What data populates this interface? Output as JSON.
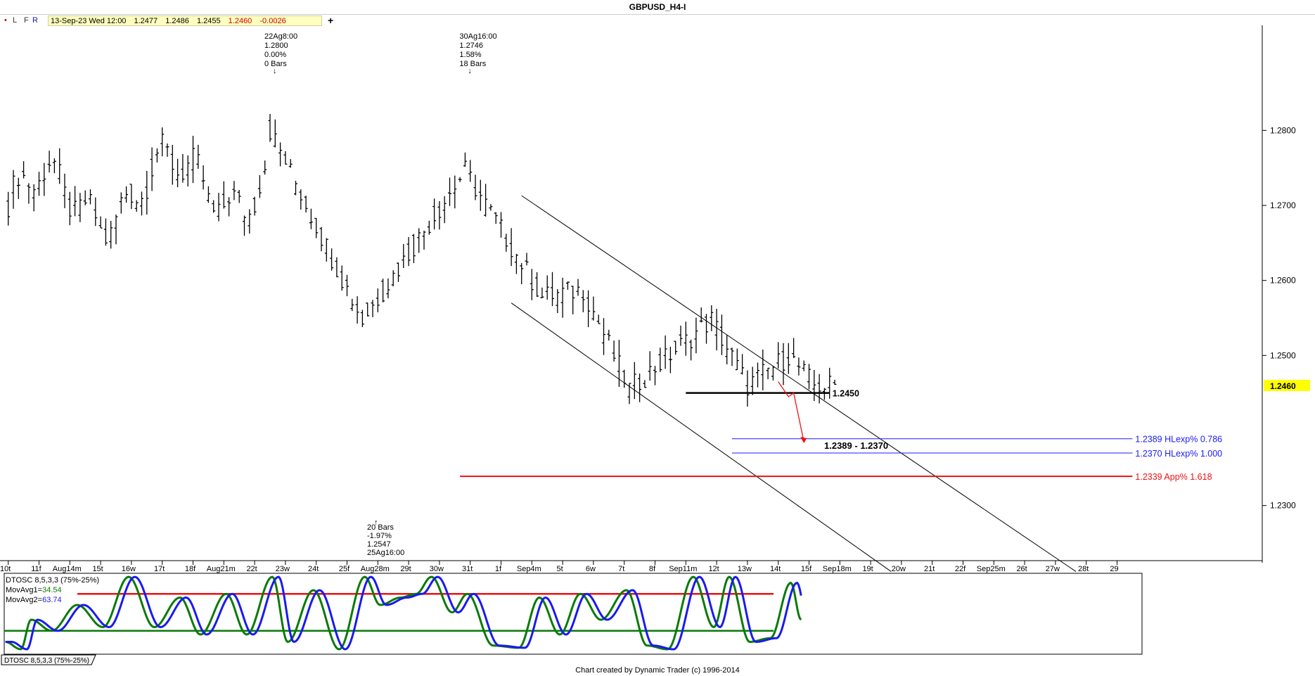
{
  "window": {
    "title": "GBPUSD_H4-I"
  },
  "toolbar": {
    "buttons": [
      {
        "label": "•",
        "color": "#cc0000"
      },
      {
        "label": "L",
        "color": "#333333"
      },
      {
        "label": "F",
        "color": "#333333"
      },
      {
        "label": "R",
        "color": "#1a1aa0"
      }
    ],
    "quote": {
      "date": "13-Sep-23 Wed 12:00",
      "open": "1.2477",
      "high": "1.2486",
      "low": "1.2455",
      "close": "1.2460",
      "change": "-0.0026"
    },
    "add_label": "+"
  },
  "footer": {
    "credit": "Chart created by Dynamic Trader  (c) 1996-2014"
  },
  "chart_data": [
    {
      "type": "ohlc",
      "symbol": "GBPUSD_H4-I",
      "ylim": [
        1.222,
        1.294
      ],
      "y_ticks": [
        "1.2800",
        "1.2700",
        "1.2600",
        "1.2500",
        "1.2300"
      ],
      "y_tick_values": [
        1.28,
        1.27,
        1.26,
        1.25,
        1.23
      ],
      "last_price_label": "1.2460",
      "last_price": 1.246,
      "x_tick_labels": [
        "10t",
        "11f",
        "Aug14m",
        "15t",
        "16w",
        "17t",
        "18f",
        "Aug21m",
        "22t",
        "23w",
        "24t",
        "25f",
        "Aug28m",
        "29t",
        "30w",
        "31t",
        "1f",
        "Sep4m",
        "5t",
        "6w",
        "7t",
        "8f",
        "Sep11m",
        "12t",
        "13w",
        "14t",
        "15f",
        "Sep18m",
        "19t",
        "20w",
        "21t",
        "22f",
        "Sep25m",
        "26t",
        "27w",
        "28t",
        "29"
      ],
      "bars_per_day": 6,
      "last_bar_index": 161,
      "swing_points": [
        {
          "index": 51,
          "price": 1.28
        },
        {
          "index": 69,
          "price": 1.2547
        },
        {
          "index": 89,
          "price": 1.2746
        },
        {
          "index": 104,
          "price": 1.2578
        },
        {
          "index": 112,
          "price": 1.2588
        },
        {
          "index": 121,
          "price": 1.2455
        },
        {
          "index": 137,
          "price": 1.2548
        },
        {
          "index": 144,
          "price": 1.246
        },
        {
          "index": 152,
          "price": 1.25
        },
        {
          "index": 157,
          "price": 1.246
        }
      ],
      "annotations": [
        {
          "lines": [
            "22Ag8:00",
            "1.2800",
            "0.00%",
            "0 Bars"
          ],
          "arrow": "↓",
          "index": 51,
          "position": "above"
        },
        {
          "lines": [
            "30Ag16:00",
            "1.2746",
            "1.58%",
            "18 Bars"
          ],
          "arrow": "↓",
          "index": 89,
          "position": "above"
        },
        {
          "lines": [
            "20 Bars",
            "-1.97%",
            "1.2547",
            "25Ag16:00"
          ],
          "arrow": "↑",
          "index": 71,
          "position": "below"
        }
      ],
      "levels": [
        {
          "label": "1.2450",
          "price": 1.245,
          "color": "#000000",
          "width": 2.5,
          "from_index": 132,
          "to_index": 160
        },
        {
          "label": "1.2389 HLexp% 0.786",
          "price": 1.2389,
          "color": "#1a1aff",
          "width": 1,
          "from_index": 141,
          "to_index": 219
        },
        {
          "label": "1.2370 HLexp% 1.000",
          "price": 1.237,
          "color": "#1a1aff",
          "width": 1,
          "from_index": 141,
          "to_index": 219
        },
        {
          "label": "1.2339 App% 1.618",
          "price": 1.2339,
          "color": "#ee1111",
          "width": 2,
          "from_index": 88,
          "to_index": 219
        }
      ],
      "zone_label": "1.2389 - 1.2370",
      "channel": {
        "upper": [
          {
            "index": 100,
            "price": 1.2713
          },
          {
            "index": 208,
            "price": 1.2212
          }
        ],
        "lower": [
          {
            "index": 98,
            "price": 1.257
          },
          {
            "index": 172,
            "price": 1.2212
          }
        ]
      },
      "projection_arrow": {
        "color": "#ee1111",
        "points": [
          [
            150,
            1.2465
          ],
          [
            152,
            1.2445
          ],
          [
            153,
            1.245
          ],
          [
            155,
            1.2385
          ]
        ]
      }
    },
    {
      "type": "line",
      "title": "DTOSC 8,5,3,3 (75%-25%)",
      "ylim": [
        0,
        100
      ],
      "levels": [
        {
          "value": 75,
          "color": "#ee1111"
        },
        {
          "value": 25,
          "color": "#0a7a0a"
        }
      ],
      "series": [
        {
          "name": "MovAvg1",
          "value_label": "34.54",
          "color": "#0a7a0a"
        },
        {
          "name": "MovAvg2",
          "value_label": "63.74",
          "color": "#1a1aee"
        }
      ],
      "swing_points": [
        [
          0,
          10
        ],
        [
          3,
          0
        ],
        [
          5,
          40
        ],
        [
          9,
          25
        ],
        [
          14,
          60
        ],
        [
          19,
          30
        ],
        [
          24,
          98
        ],
        [
          29,
          30
        ],
        [
          34,
          70
        ],
        [
          38,
          20
        ],
        [
          43,
          75
        ],
        [
          47,
          20
        ],
        [
          52,
          98
        ],
        [
          55,
          10
        ],
        [
          60,
          80
        ],
        [
          65,
          0
        ],
        [
          70,
          98
        ],
        [
          73,
          60
        ],
        [
          77,
          70
        ],
        [
          80,
          75
        ],
        [
          83,
          98
        ],
        [
          87,
          50
        ],
        [
          90,
          75
        ],
        [
          95,
          5
        ],
        [
          100,
          2
        ],
        [
          104,
          70
        ],
        [
          108,
          20
        ],
        [
          112,
          75
        ],
        [
          116,
          40
        ],
        [
          121,
          80
        ],
        [
          125,
          5
        ],
        [
          129,
          0
        ],
        [
          134,
          98
        ],
        [
          138,
          30
        ],
        [
          141,
          98
        ],
        [
          145,
          10
        ],
        [
          149,
          15
        ],
        [
          153,
          90
        ],
        [
          155,
          40
        ]
      ],
      "tab_label": "DTOSC 8,5,3,3 (75%-25%)"
    }
  ]
}
